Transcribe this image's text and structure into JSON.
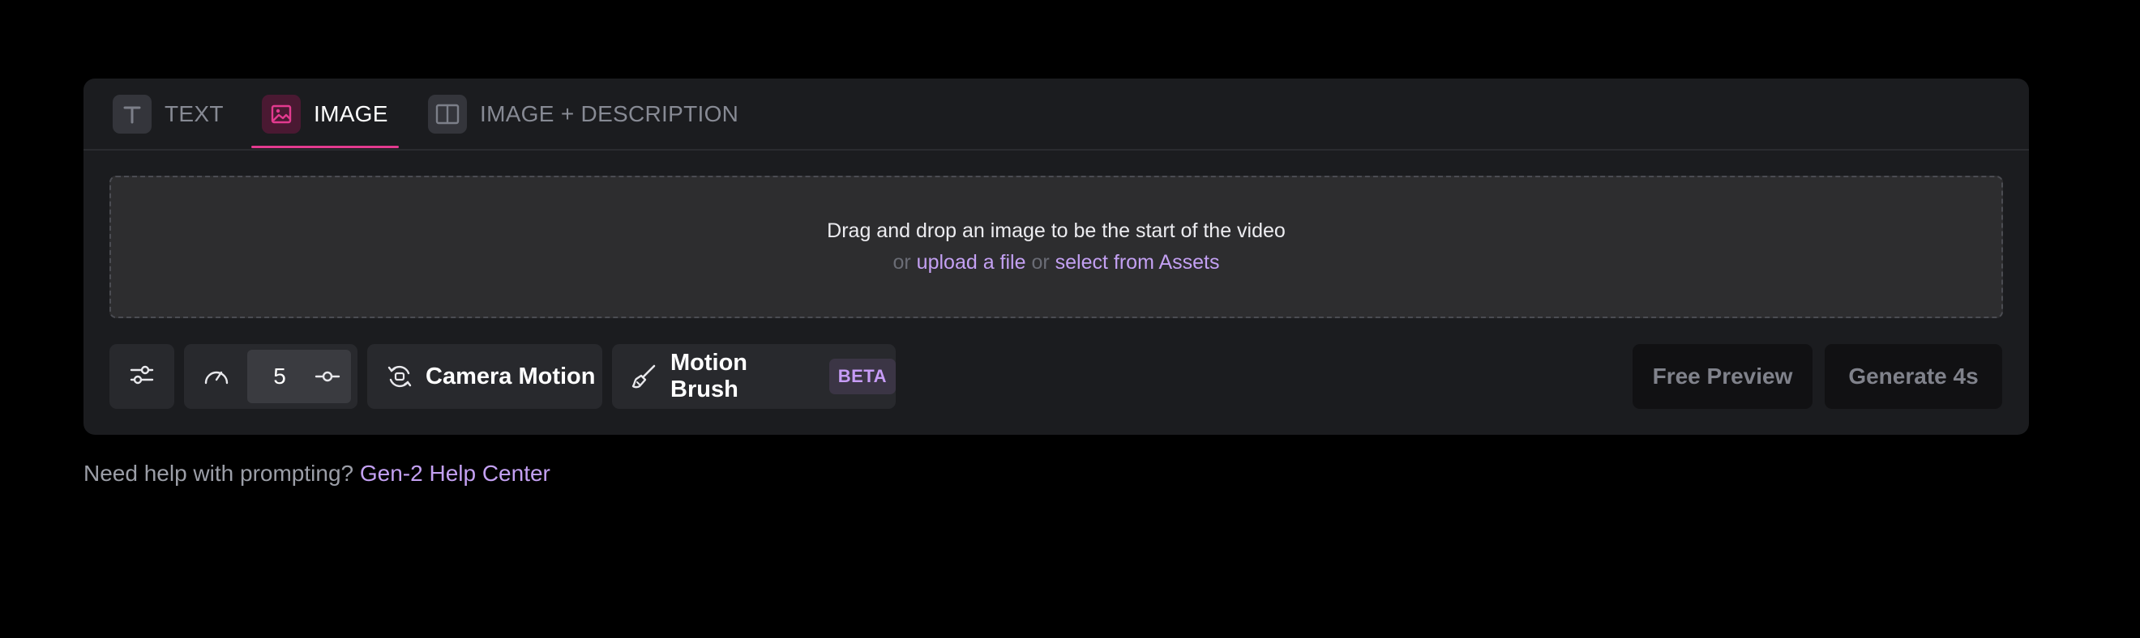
{
  "tabs": [
    {
      "label": "TEXT",
      "icon": "text-t-icon",
      "active": false
    },
    {
      "label": "IMAGE",
      "icon": "image-icon",
      "active": true
    },
    {
      "label": "IMAGE + DESCRIPTION",
      "icon": "split-panel-icon",
      "active": false
    }
  ],
  "dropzone": {
    "main_text": "Drag and drop an image to be the start of the video",
    "or_1": "or",
    "upload_link": "upload a file",
    "or_2": "or",
    "assets_link": "select from Assets"
  },
  "toolbar": {
    "settings_icon": "sliders-icon",
    "speed_icon": "speedometer-icon",
    "motion_value": "5",
    "motion_step_icon": "node-icon",
    "camera_motion_label": "Camera Motion",
    "camera_icon": "camera-rotate-icon",
    "motion_brush_label": "Motion Brush",
    "brush_icon": "brush-icon",
    "beta_badge": "BETA",
    "free_preview_label": "Free Preview",
    "generate_label": "Generate 4s"
  },
  "help": {
    "text": "Need help with prompting?",
    "link": "Gen-2 Help Center"
  },
  "colors": {
    "background": "#000000",
    "panel": "#1b1c1f",
    "accent_pink": "#e33a8f",
    "link_purple": "#c3a0f2"
  }
}
